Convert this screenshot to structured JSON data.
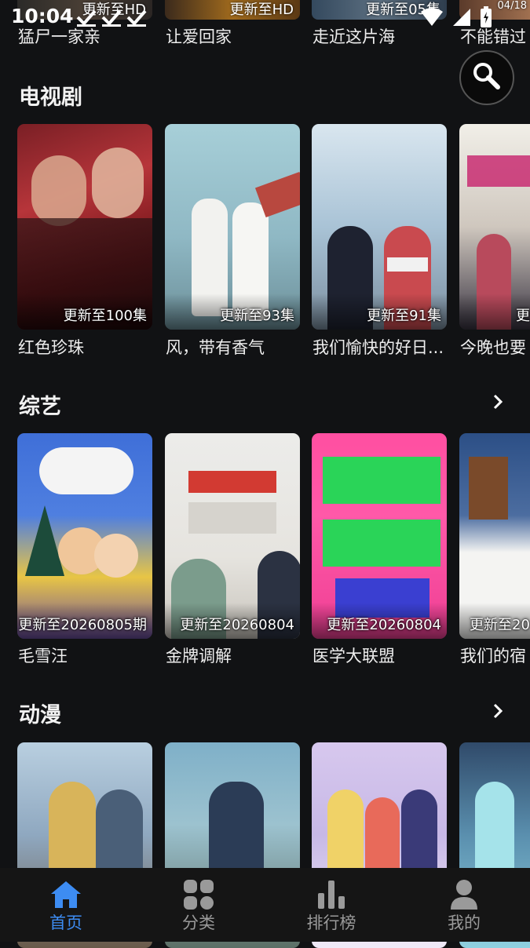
{
  "status": {
    "time": "10:04"
  },
  "top_row": [
    {
      "badge": "更新至HD",
      "title": "猛尸一家亲"
    },
    {
      "badge": "更新至HD",
      "title": "让爱回家"
    },
    {
      "badge": "更新至05集",
      "title": "走近这片海"
    },
    {
      "badge": "04/18",
      "title": "不能错过"
    }
  ],
  "sections": [
    {
      "title": "电视剧",
      "items": [
        {
          "badge": "更新至100集",
          "title": "红色珍珠"
        },
        {
          "badge": "更新至93集",
          "title": "风，带有香气"
        },
        {
          "badge": "更新至91集",
          "title": "我们愉快的好日..."
        },
        {
          "badge": "更",
          "title": "今晚也要"
        }
      ]
    },
    {
      "title": "综艺",
      "items": [
        {
          "badge": "更新至20260805期",
          "title": "毛雪汪"
        },
        {
          "badge": "更新至20260804",
          "title": "金牌调解"
        },
        {
          "badge": "更新至20260804",
          "title": "医学大联盟"
        },
        {
          "badge": "更新至20",
          "title": "我们的宿"
        }
      ]
    },
    {
      "title": "动漫",
      "items": [
        {
          "badge": "",
          "title": ""
        },
        {
          "badge": "",
          "title": ""
        },
        {
          "badge": "",
          "title": ""
        },
        {
          "badge": "",
          "title": ""
        }
      ]
    }
  ],
  "nav": [
    {
      "label": "首页",
      "icon": "home-icon",
      "active": true
    },
    {
      "label": "分类",
      "icon": "category-icon",
      "active": false
    },
    {
      "label": "排行榜",
      "icon": "ranking-icon",
      "active": false
    },
    {
      "label": "我的",
      "icon": "profile-icon",
      "active": false
    }
  ],
  "colors": {
    "accent": "#3d8cf2",
    "background": "#111214",
    "nav_bg": "#151515"
  }
}
